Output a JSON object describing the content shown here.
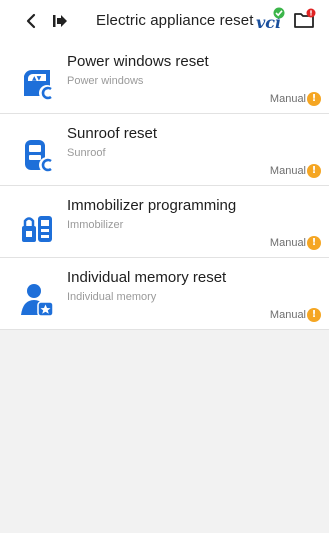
{
  "header": {
    "title": "Electric appliance reset",
    "vci_label": "vci"
  },
  "items": [
    {
      "name": "Power windows reset",
      "sub": "Power windows",
      "mode": "Manual",
      "warn": "!"
    },
    {
      "name": "Sunroof reset",
      "sub": "Sunroof",
      "mode": "Manual",
      "warn": "!"
    },
    {
      "name": "Immobilizer programming",
      "sub": "Immobilizer",
      "mode": "Manual",
      "warn": "!"
    },
    {
      "name": "Individual memory reset",
      "sub": "Individual memory",
      "mode": "Manual",
      "warn": "!"
    }
  ],
  "colors": {
    "accent": "#1e6fd9",
    "warning": "#f5a623",
    "vci_ok": "#3bb54a",
    "alert": "#e02424"
  }
}
